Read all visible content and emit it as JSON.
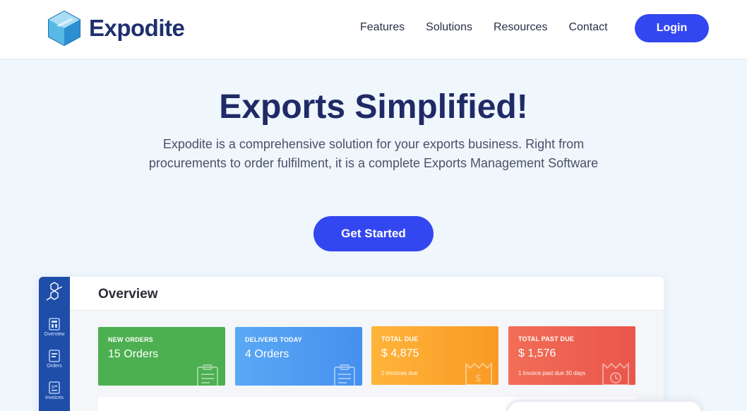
{
  "brand": {
    "name": "Expodite"
  },
  "nav": {
    "items": [
      {
        "label": "Features"
      },
      {
        "label": "Solutions"
      },
      {
        "label": "Resources"
      },
      {
        "label": "Contact"
      }
    ],
    "login_label": "Login"
  },
  "hero": {
    "title": "Exports Simplified!",
    "subtitle": "Expodite is a comprehensive solution for your exports business. Right from procurements to order fulfilment, it is a complete Exports Management Software",
    "cta_label": "Get Started"
  },
  "dashboard": {
    "title": "Overview",
    "sidebar": [
      {
        "label": "Overview",
        "icon": "overview-icon"
      },
      {
        "label": "Orders",
        "icon": "orders-icon"
      },
      {
        "label": "Invoices",
        "icon": "invoices-icon"
      }
    ],
    "cards": [
      {
        "label": "NEW ORDERS",
        "value": "15 Orders",
        "note": "",
        "color": "#4caf50",
        "icon": "clipboard-icon"
      },
      {
        "label": "DELIVERS TODAY",
        "value": "4 Orders",
        "note": "",
        "color": "#4e9cf2",
        "icon": "clipboard-icon"
      },
      {
        "label": "TOTAL DUE",
        "value": "$ 4,875",
        "note": "2 Invoices due",
        "color": "#fba92e",
        "icon": "receipt-dollar-icon"
      },
      {
        "label": "TOTAL PAST DUE",
        "value": "$ 1,576",
        "note": "1 Invoice past due 30 days",
        "color": "#ee6251",
        "icon": "receipt-clock-icon"
      }
    ]
  },
  "colors": {
    "accent": "#3347f0",
    "heading": "#1f2a66",
    "sidebar": "#1e4ea8",
    "background": "#eff6fc"
  }
}
